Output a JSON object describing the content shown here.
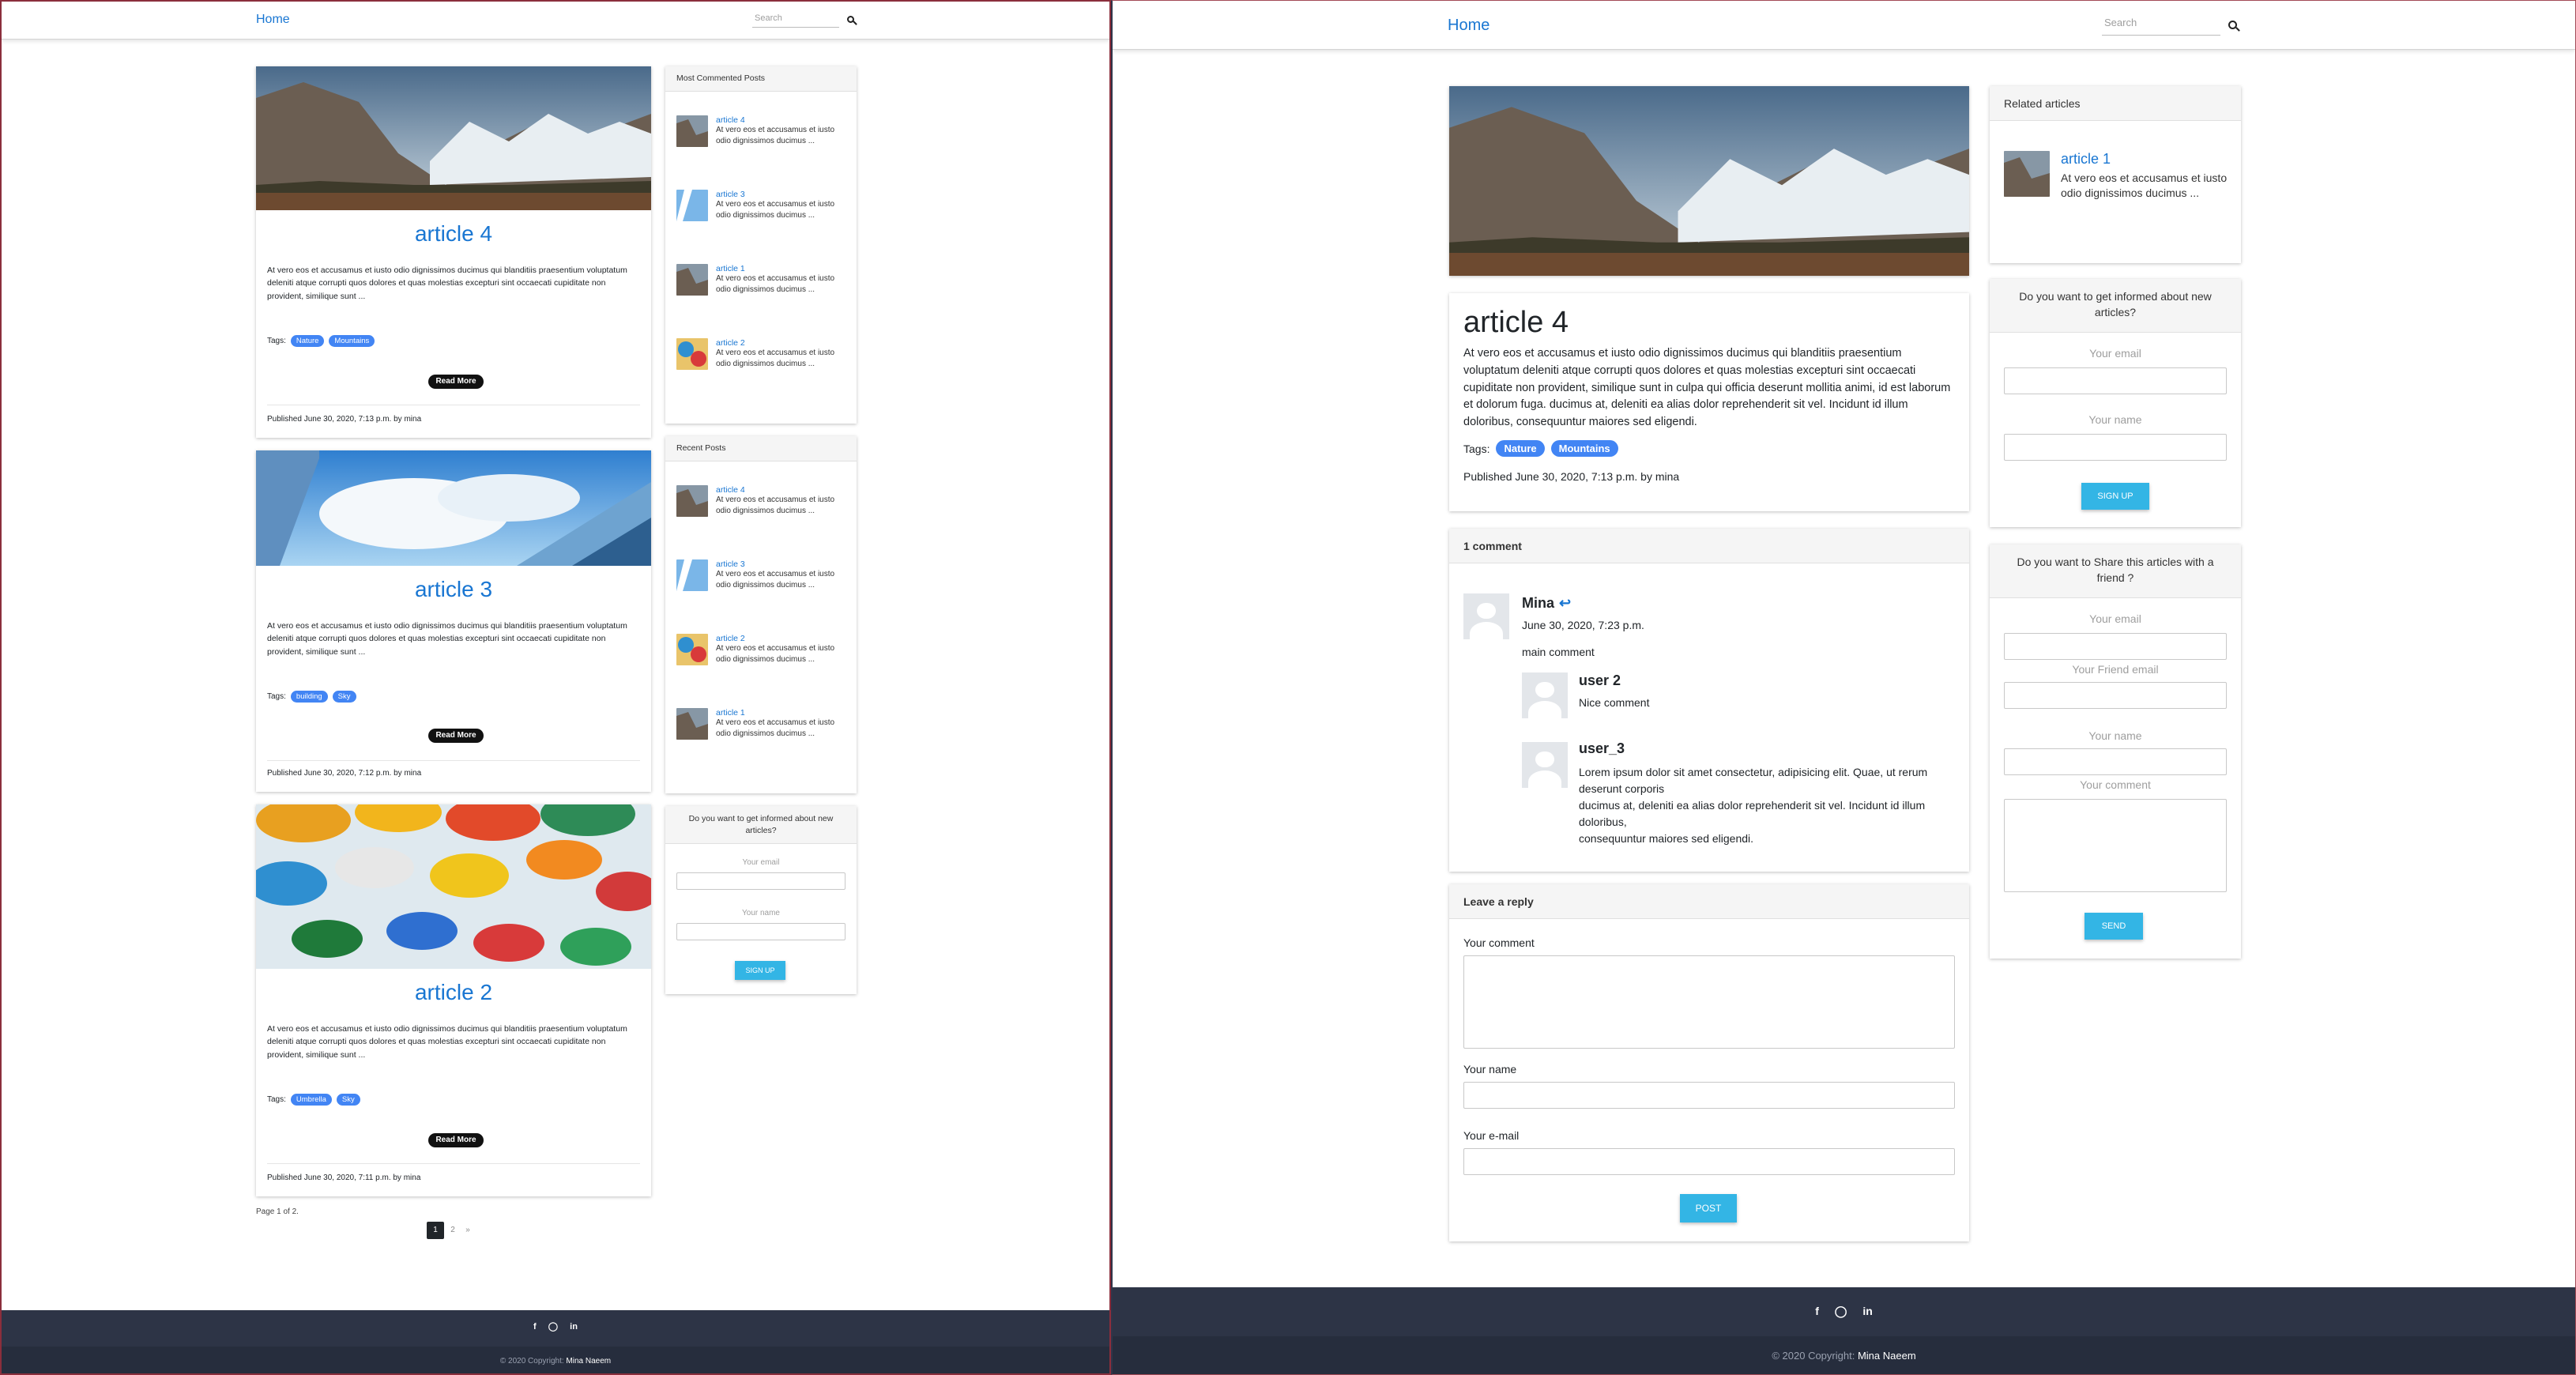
{
  "nav": {
    "home": "Home",
    "search_placeholder": "Search"
  },
  "posts": [
    {
      "title": "article 4",
      "excerpt": "At vero eos et accusamus et iusto odio dignissimos ducimus qui blanditiis praesentium voluptatum deleniti atque corrupti quos dolores et quas molestias excepturi sint occaecati cupiditate non provident, similique sunt ...",
      "tags_label": "Tags:",
      "tags": [
        "Nature",
        "Mountains"
      ],
      "read_more": "Read More",
      "published": "Published June 30, 2020, 7:13 p.m. by mina"
    },
    {
      "title": "article 3",
      "excerpt": "At vero eos et accusamus et iusto odio dignissimos ducimus qui blanditiis praesentium voluptatum deleniti atque corrupti quos dolores et quas molestias excepturi sint occaecati cupiditate non provident, similique sunt ...",
      "tags_label": "Tags:",
      "tags": [
        "building",
        "Sky"
      ],
      "read_more": "Read More",
      "published": "Published June 30, 2020, 7:12 p.m. by mina"
    },
    {
      "title": "article 2",
      "excerpt": "At vero eos et accusamus et iusto odio dignissimos ducimus qui blanditiis praesentium voluptatum deleniti atque corrupti quos dolores et quas molestias excepturi sint occaecati cupiditate non provident, similique sunt ...",
      "tags_label": "Tags:",
      "tags": [
        "Umbrella",
        "Sky"
      ],
      "read_more": "Read More",
      "published": "Published June 30, 2020, 7:11 p.m. by mina"
    }
  ],
  "pagination": {
    "info": "Page 1 of 2.",
    "pages": [
      "1",
      "2",
      "»"
    ]
  },
  "most_commented": {
    "title": "Most Commented Posts",
    "items": [
      {
        "title": "article 4",
        "excerpt": "At vero eos et accusamus et iusto odio dignissimos ducimus ..."
      },
      {
        "title": "article 3",
        "excerpt": "At vero eos et accusamus et iusto odio dignissimos ducimus ..."
      },
      {
        "title": "article 1",
        "excerpt": "At vero eos et accusamus et iusto odio dignissimos ducimus ..."
      },
      {
        "title": "article 2",
        "excerpt": "At vero eos et accusamus et iusto odio dignissimos ducimus ..."
      }
    ]
  },
  "recent": {
    "title": "Recent Posts",
    "items": [
      {
        "title": "article 4",
        "excerpt": "At vero eos et accusamus et iusto odio dignissimos ducimus ..."
      },
      {
        "title": "article 3",
        "excerpt": "At vero eos et accusamus et iusto odio dignissimos ducimus ..."
      },
      {
        "title": "article 2",
        "excerpt": "At vero eos et accusamus et iusto odio dignissimos ducimus ..."
      },
      {
        "title": "article 1",
        "excerpt": "At vero eos et accusamus et iusto odio dignissimos ducimus ..."
      }
    ]
  },
  "subscribe": {
    "title": "Do you want to get informed about new articles?",
    "email": "Your email",
    "name": "Your name",
    "button": "SIGN UP"
  },
  "footer": {
    "copyright": "© 2020 Copyright:",
    "author": "Mina Naeem",
    "icons": [
      "facebook-icon",
      "github-icon",
      "linkedin-icon"
    ]
  },
  "detail": {
    "title": "article 4",
    "body": "At vero eos et accusamus et iusto odio dignissimos ducimus qui blanditiis praesentium voluptatum deleniti atque corrupti quos dolores et quas molestias excepturi sint occaecati cupiditate non provident, similique sunt in culpa qui officia deserunt mollitia animi, id est laborum et dolorum fuga. ducimus at, deleniti ea alias dolor reprehenderit sit vel. Incidunt id illum doloribus, consequuntur maiores sed eligendi.",
    "tags_label": "Tags:",
    "tags": [
      "Nature",
      "Mountains"
    ],
    "published": "Published June 30, 2020, 7:13 p.m. by mina",
    "comments_header": "1 comment",
    "comment": {
      "author": "Mina",
      "date": "June 30, 2020, 7:23 p.m.",
      "text": "main comment"
    },
    "replies": [
      {
        "author": "user 2",
        "text": "Nice comment"
      },
      {
        "author": "user_3",
        "text": "Lorem ipsum dolor sit amet consectetur, adipisicing elit. Quae, ut rerum deserunt corporis\nducimus at, deleniti ea alias dolor reprehenderit sit vel. Incidunt id illum doloribus,\nconsequuntur maiores sed eligendi."
      }
    ],
    "reply_form": {
      "title": "Leave a reply",
      "comment": "Your comment",
      "name": "Your name",
      "email": "Your e-mail",
      "button": "POST"
    }
  },
  "related": {
    "title": "Related articles",
    "items": [
      {
        "title": "article 1",
        "excerpt": "At vero eos et accusamus et iusto odio dignissimos ducimus ..."
      }
    ]
  },
  "subscribe2": {
    "title": "Do you want to get informed about new articles?",
    "email": "Your email",
    "name": "Your name",
    "button": "SIGN UP"
  },
  "share": {
    "title": "Do you want to Share this articles with a friend ?",
    "email": "Your email",
    "friend_email": "Your Friend email",
    "name": "Your name",
    "comment": "Your comment",
    "button": "SEND"
  }
}
